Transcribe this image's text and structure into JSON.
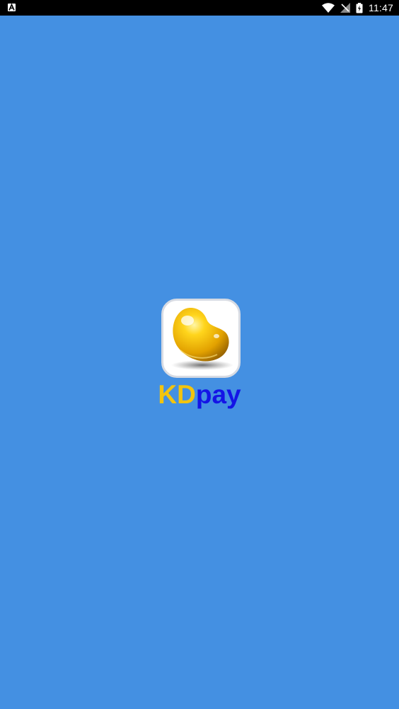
{
  "status_bar": {
    "notification_icon": "text-a-notification-icon",
    "icons": [
      "wifi-icon",
      "no-signal-icon",
      "battery-charging-icon"
    ],
    "time": "11:47"
  },
  "splash": {
    "app_icon": "bean-logo-icon",
    "app_name_part1": "KD",
    "app_name_part2": "pay"
  },
  "colors": {
    "background": "#4490E2",
    "status_bar": "#000000",
    "brand_yellow": "#F2C40E",
    "brand_blue": "#1414E6"
  }
}
